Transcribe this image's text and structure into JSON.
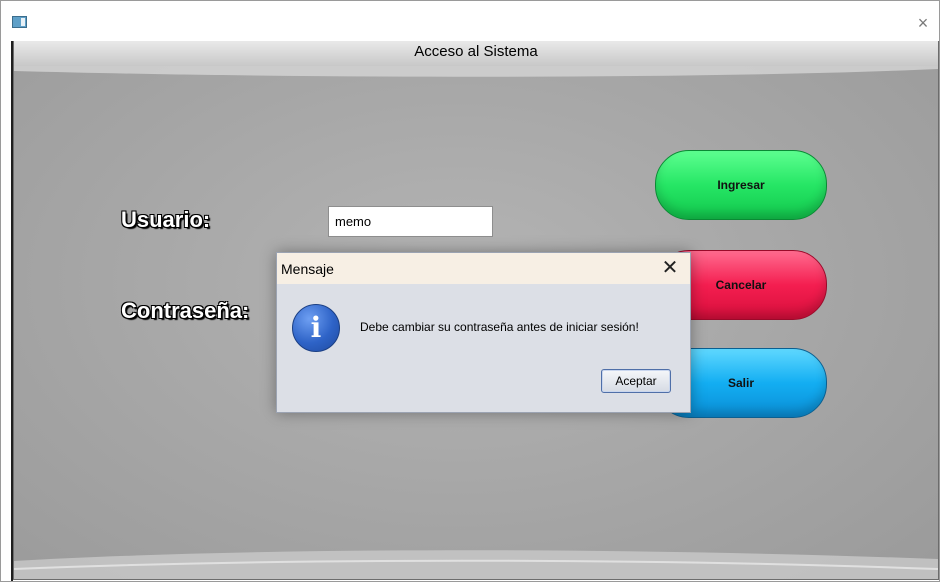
{
  "window": {
    "close_glyph": "×",
    "icon": "app-window-icon"
  },
  "form": {
    "title": "Acceso al Sistema",
    "user_label": "Usuario:",
    "user_value": "memo",
    "password_label": "Contraseña:",
    "buttons": {
      "login": "Ingresar",
      "cancel": "Cancelar",
      "exit": "Salir"
    }
  },
  "dialog": {
    "title": "Mensaje",
    "close_glyph": "✕",
    "icon": "info-icon",
    "icon_glyph": "i",
    "message": "Debe cambiar su contraseña antes de iniciar sesión!",
    "ok_label": "Aceptar"
  },
  "colors": {
    "login_button": "#26e665",
    "cancel_button": "#f41e50",
    "exit_button": "#13aef2",
    "background": "#a8a8a8",
    "info_icon": "#2e63c7"
  }
}
